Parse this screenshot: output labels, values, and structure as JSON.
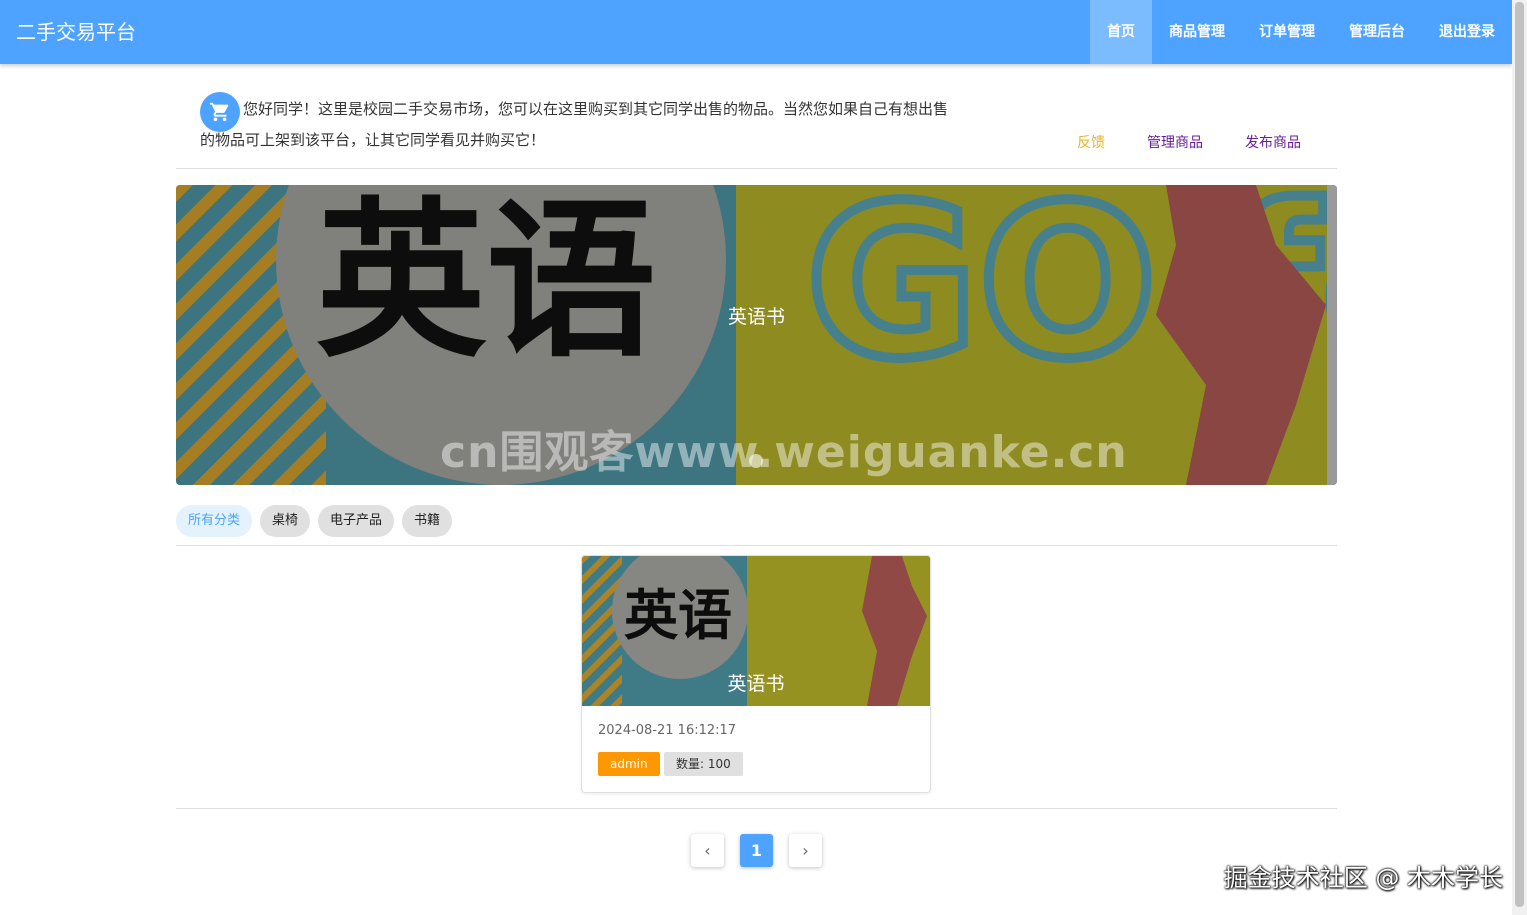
{
  "header": {
    "brand": "二手交易平台",
    "nav": [
      "首页",
      "商品管理",
      "订单管理",
      "管理后台",
      "退出登录"
    ]
  },
  "intro": {
    "icon": "cart-icon",
    "text": "您好同学！这里是校园二手交易市场，您可以在这里购买到其它同学出售的物品。当然您如果自己有想出售的物品可上架到该平台，让其它同学看见并购买它！"
  },
  "links": {
    "feedback": "反馈",
    "manage": "管理商品",
    "publish": "发布商品"
  },
  "colors": {
    "primary": "#4da3ff",
    "feedback": "#e6b422",
    "link": "#6a1b9a",
    "admin_tag": "#ff9800"
  },
  "banner": {
    "caption": "英语书",
    "title_art": "英语",
    "art_text": "GO for",
    "watermark": "cn围观客www.weiguanke.cn"
  },
  "categories": [
    "所有分类",
    "桌椅",
    "电子产品",
    "书籍"
  ],
  "card": {
    "caption": "英语书",
    "title_art": "英语",
    "date": "2024-08-21 16:12:17",
    "user": "admin",
    "qty": "数量: 100"
  },
  "pagination": {
    "prev": "‹",
    "page": "1",
    "next": "›"
  },
  "footer_watermark": "掘金技术社区 @ 木木学长"
}
